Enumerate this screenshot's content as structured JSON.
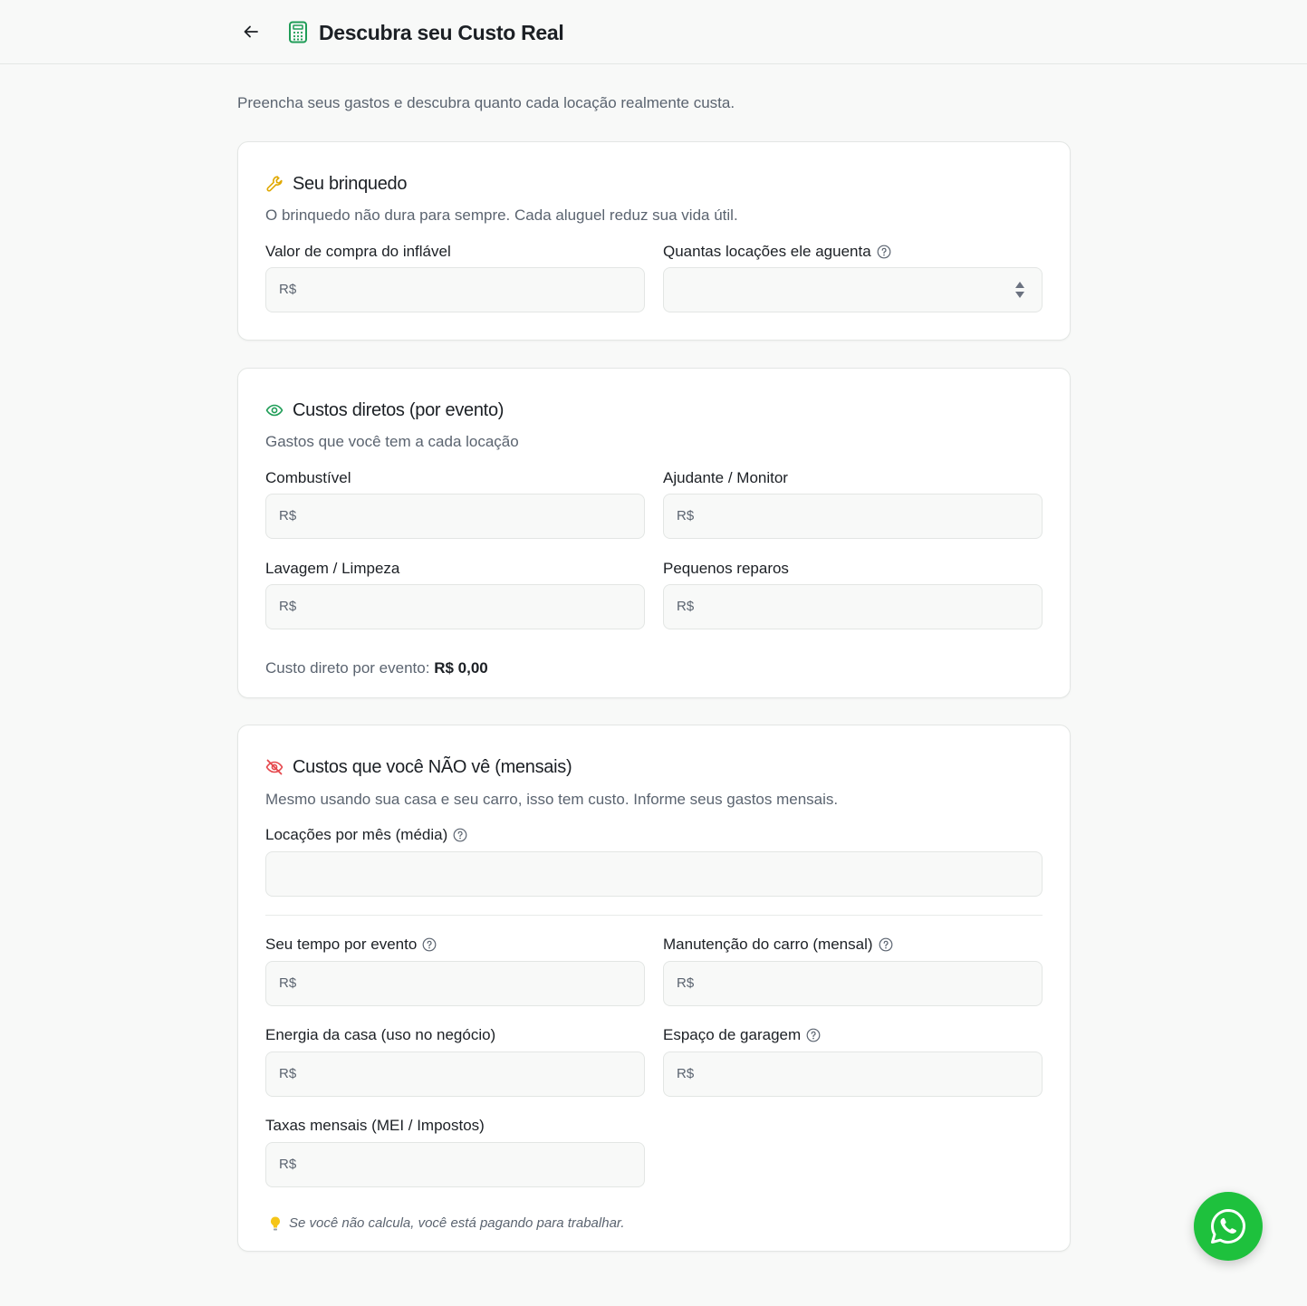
{
  "header": {
    "title": "Descubra seu Custo Real",
    "back_icon": "arrow-left-icon",
    "title_icon": "calculator-icon"
  },
  "intro": "Preencha seus gastos e descubra quanto cada locação realmente custa.",
  "currency_prefix": "R$",
  "colors": {
    "accent_green": "#1f9d57",
    "warning_yellow": "#e0a800",
    "alert_red": "#e5484d",
    "whatsapp_green": "#1ec13d"
  },
  "section_toy": {
    "title": "Seu brinquedo",
    "icon": "wrench-icon",
    "description": "O brinquedo não dura para sempre. Cada aluguel reduz sua vida útil.",
    "purchase_label": "Valor de compra do inflável",
    "purchase_value": "",
    "lifespan_label": "Quantas locações ele aguenta",
    "lifespan_value": ""
  },
  "section_direct": {
    "title": "Custos diretos (por evento)",
    "icon": "eye-icon",
    "description": "Gastos que você tem a cada locação",
    "fuel_label": "Combustível",
    "helper_label": "Ajudante / Monitor",
    "cleaning_label": "Lavagem / Limpeza",
    "repairs_label": "Pequenos reparos",
    "summary_label": "Custo direto por evento:",
    "summary_value": "R$ 0,00"
  },
  "section_hidden": {
    "title": "Custos que você NÃO vê (mensais)",
    "icon": "eye-off-icon",
    "description": "Mesmo usando sua casa e seu carro, isso tem custo. Informe seus gastos mensais.",
    "rentals_label": "Locações por mês (média)",
    "time_label": "Seu tempo por evento",
    "car_label": "Manutenção do carro (mensal)",
    "energy_label": "Energia da casa (uso no negócio)",
    "garage_label": "Espaço de garagem",
    "taxes_label": "Taxas mensais (MEI / Impostos)",
    "tip": "Se você não calcula, você está pagando para trabalhar.",
    "tip_icon": "lightbulb-icon"
  },
  "whatsapp": {
    "icon": "whatsapp-icon"
  }
}
